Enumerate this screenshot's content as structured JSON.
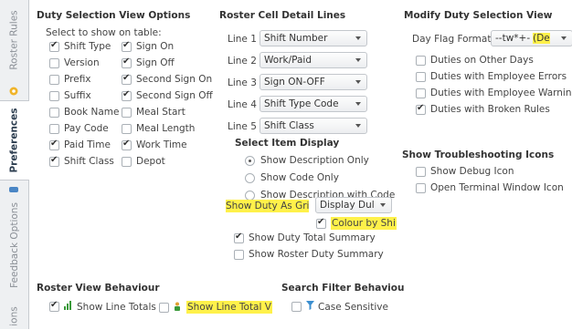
{
  "sidebar": {
    "tabs": [
      {
        "label": "Roster Rules"
      },
      {
        "label": "Preferences"
      },
      {
        "label": "Feedback Options"
      },
      {
        "label": "ions"
      }
    ]
  },
  "duty_selection": {
    "title": "Duty Selection View Options",
    "subtitle": "Select to show on table:",
    "col1": [
      {
        "label": "Shift Type",
        "checked": true
      },
      {
        "label": "Version",
        "checked": false
      },
      {
        "label": "Prefix",
        "checked": false
      },
      {
        "label": "Suffix",
        "checked": false
      },
      {
        "label": "Book Name",
        "checked": false
      },
      {
        "label": "Pay Code",
        "checked": false
      },
      {
        "label": "Paid Time",
        "checked": true
      },
      {
        "label": "Shift Class",
        "checked": true
      }
    ],
    "col2": [
      {
        "label": "Sign On",
        "checked": true
      },
      {
        "label": "Sign Off",
        "checked": true
      },
      {
        "label": "Second Sign On",
        "checked": true
      },
      {
        "label": "Second Sign Off",
        "checked": true
      },
      {
        "label": "Meal Start",
        "checked": false
      },
      {
        "label": "Meal Length",
        "checked": false
      },
      {
        "label": "Work Time",
        "checked": true
      },
      {
        "label": "Depot",
        "checked": false
      }
    ]
  },
  "roster_cell": {
    "title": "Roster Cell Detail Lines",
    "lines": [
      {
        "label": "Line 1",
        "value": "Shift Number"
      },
      {
        "label": "Line 2",
        "value": "Work/Paid"
      },
      {
        "label": "Line 3",
        "value": "Sign ON-OFF"
      },
      {
        "label": "Line 4",
        "value": "Shift Type Code"
      },
      {
        "label": "Line 5",
        "value": "Shift Class"
      }
    ]
  },
  "select_item": {
    "title": "Select Item Display",
    "options": [
      {
        "label": "Show Description Only",
        "selected": true
      },
      {
        "label": "Show Code Only",
        "selected": false
      },
      {
        "label": "Show Description with Code",
        "selected": false
      }
    ],
    "show_duty_label": "Show Duty As Gri",
    "show_duty_value": "Display Dul",
    "colour_by": {
      "label": "Colour by Shi",
      "checked": true
    },
    "summaries": [
      {
        "label": "Show Duty Total Summary",
        "checked": true
      },
      {
        "label": "Show Roster Duty Summary",
        "checked": false
      }
    ]
  },
  "modify_duty": {
    "title": "Modify Duty Selection View",
    "day_flag_label": "Day Flag Format",
    "day_flag_value": "--tw*+-",
    "day_flag_value_hl": "(De",
    "options": [
      {
        "label": "Duties on Other Days",
        "checked": false
      },
      {
        "label": "Duties with Employee Errors",
        "checked": false
      },
      {
        "label": "Duties with Employee Warning",
        "checked": false
      },
      {
        "label": "Duties with Broken Rules",
        "checked": true
      }
    ]
  },
  "troubleshooting": {
    "title": "Show Troubleshooting Icons",
    "options": [
      {
        "label": "Show Debug Icon",
        "checked": false
      },
      {
        "label": "Open Terminal Window Icon",
        "checked": false
      }
    ]
  },
  "roster_view": {
    "title": "Roster View  Behaviour",
    "show_line_totals": {
      "label": "Show Line Totals",
      "checked": true
    },
    "show_line_total_v": {
      "label": "Show Line Total V",
      "checked": false
    }
  },
  "search_filter": {
    "title": "Search Filter Behaviou",
    "case_sensitive": {
      "label": "Case Sensitive",
      "checked": false
    }
  },
  "colors": {
    "highlight": "#fff14a",
    "active_tab_text": "#2d3e50",
    "bar_green": "#3a9a3a",
    "filter_blue": "#3c8fd0"
  }
}
